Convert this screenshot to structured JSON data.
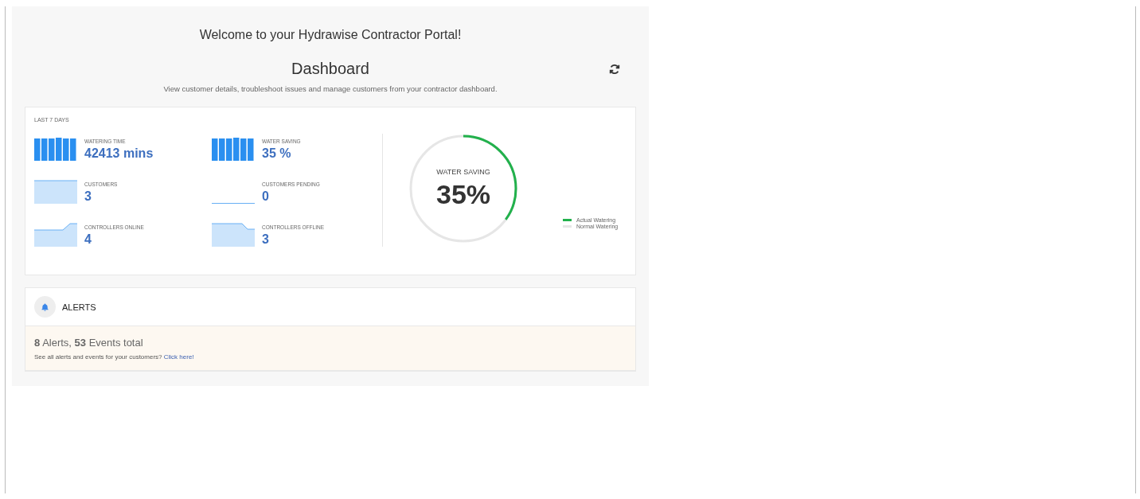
{
  "welcome": "Welcome to your Hydrawise Contractor Portal!",
  "title": "Dashboard",
  "subtitle": "View customer details, troubleshoot issues and manage customers from your contractor dashboard.",
  "stats": {
    "period": "LAST 7 DAYS",
    "items": [
      {
        "label": "WATERING TIME",
        "value": "42413 mins",
        "kind": "bars"
      },
      {
        "label": "WATER SAVING",
        "value": "35 %",
        "kind": "bars"
      },
      {
        "label": "CUSTOMERS",
        "value": "3",
        "kind": "full"
      },
      {
        "label": "CUSTOMERS PENDING",
        "value": "0",
        "kind": "empty"
      },
      {
        "label": "CONTROLLERS ONLINE",
        "value": "4",
        "kind": "rise"
      },
      {
        "label": "CONTROLLERS OFFLINE",
        "value": "3",
        "kind": "fall"
      }
    ],
    "gauge": {
      "label": "WATER SAVING",
      "value": "35%",
      "level": 0.35
    },
    "legend": [
      {
        "label": "Actual Watering",
        "color": "#22b14c"
      },
      {
        "label": "Normal Watering",
        "color": "#e6e6e6"
      }
    ]
  },
  "alerts": {
    "title": "ALERTS",
    "summary": "**8** Alerts, **53** Events total",
    "prompt": "See all alerts and events for your customers?",
    "link": "Click here!"
  }
}
